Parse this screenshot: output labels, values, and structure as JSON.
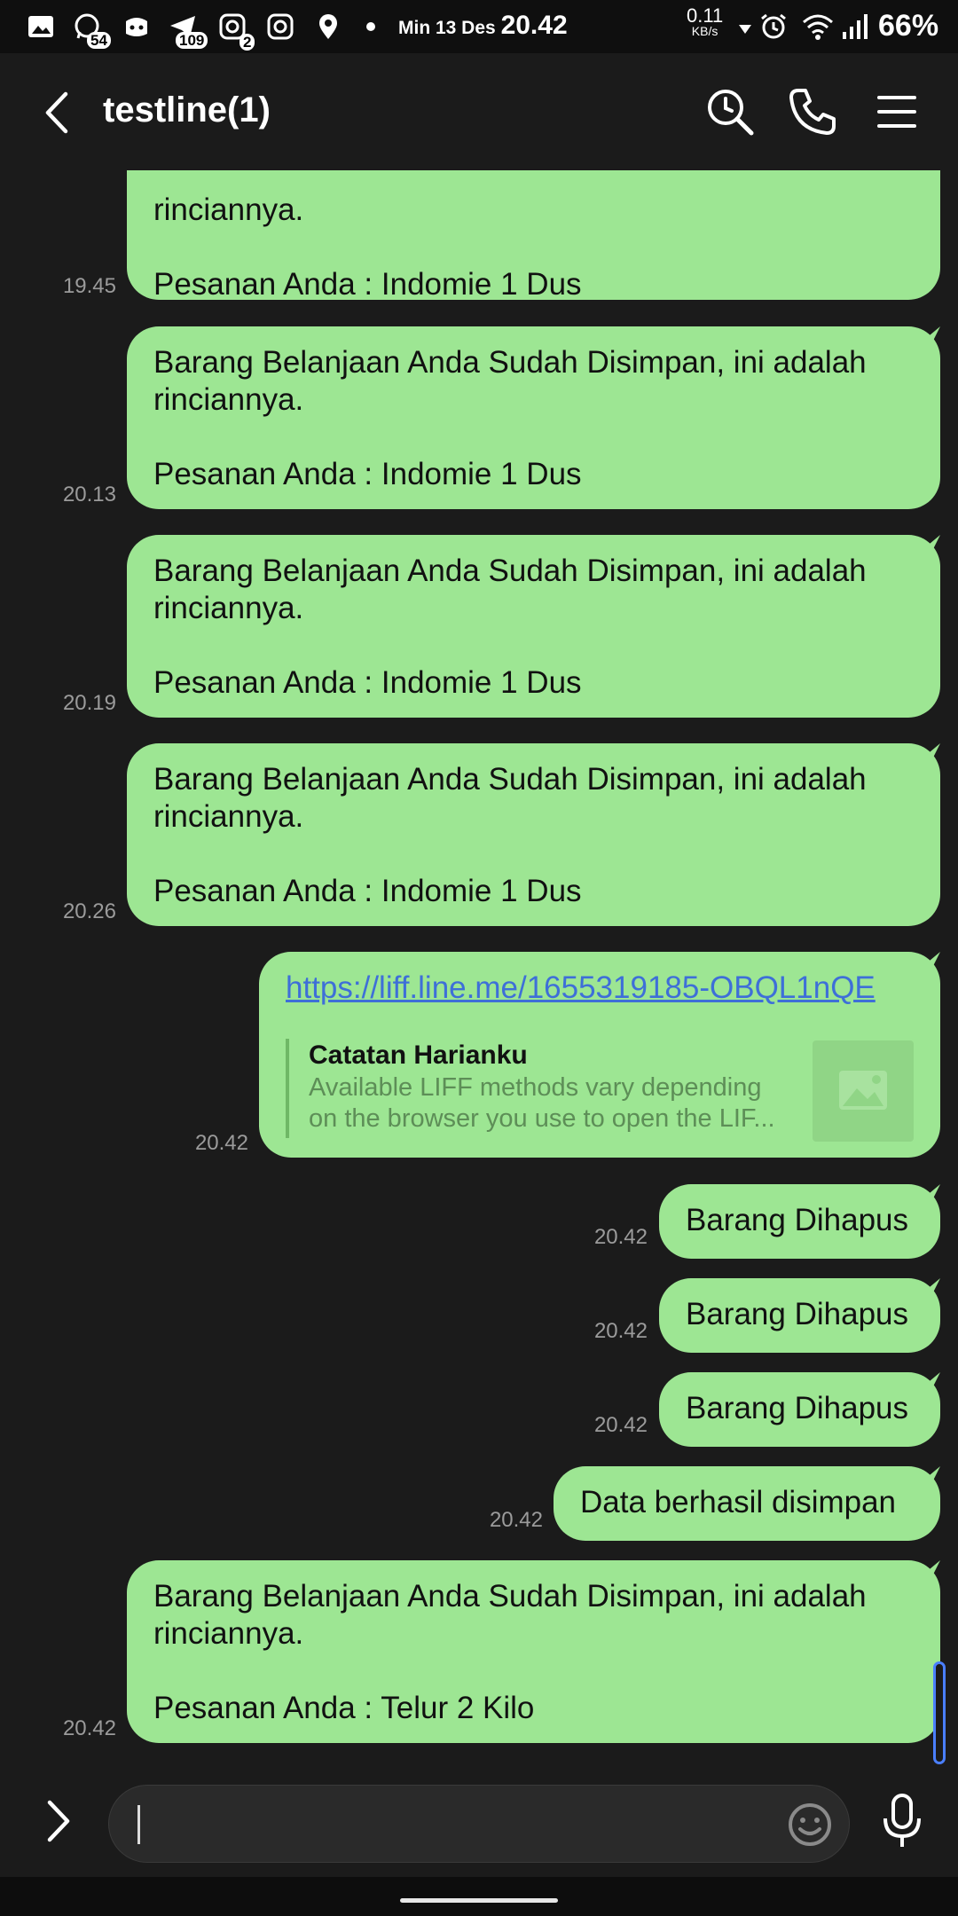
{
  "status_bar": {
    "badges": {
      "whatsapp": "54",
      "telegram": "109",
      "instagram": "2"
    },
    "date": "Min 13 Des",
    "time": "20.42",
    "net_speed": "0.11",
    "net_unit": "KB/s",
    "battery": "66%"
  },
  "header": {
    "title": "testline(1)"
  },
  "messages": [
    {
      "line1": "rinciannya.",
      "line2": "Pesanan Anda : Indomie 1 Dus",
      "time": "19.45"
    },
    {
      "text": "Barang Belanjaan Anda Sudah Disimpan, ini adalah rinciannya.\n\nPesanan Anda : Indomie 1 Dus",
      "time": "20.13"
    },
    {
      "text": "Barang Belanjaan Anda Sudah Disimpan, ini adalah rinciannya.\n\nPesanan Anda : Indomie 1 Dus",
      "time": "20.19"
    },
    {
      "text": "Barang Belanjaan Anda Sudah Disimpan, ini adalah rinciannya.\n\nPesanan Anda : Indomie 1 Dus",
      "time": "20.26"
    },
    {
      "link": "https://liff.line.me/1655319185-OBQL1nQE",
      "preview_title": "Catatan Harianku",
      "preview_desc_1": "Available LIFF methods vary depending",
      "preview_desc_2": "on the browser you use to open the LIF...",
      "time": "20.42"
    },
    {
      "text": "Barang Dihapus",
      "time": "20.42"
    },
    {
      "text": "Barang Dihapus",
      "time": "20.42"
    },
    {
      "text": "Barang Dihapus",
      "time": "20.42"
    },
    {
      "text": "Data berhasil disimpan",
      "time": "20.42"
    },
    {
      "text": "Barang Belanjaan Anda Sudah Disimpan, ini adalah rinciannya.\n\nPesanan Anda : Telur 2 Kilo",
      "time": "20.42"
    }
  ],
  "input": {
    "value": "",
    "placeholder": ""
  },
  "colors": {
    "bubble": "#9de693",
    "background": "#1b1b1b",
    "link": "#3e6fd8"
  }
}
